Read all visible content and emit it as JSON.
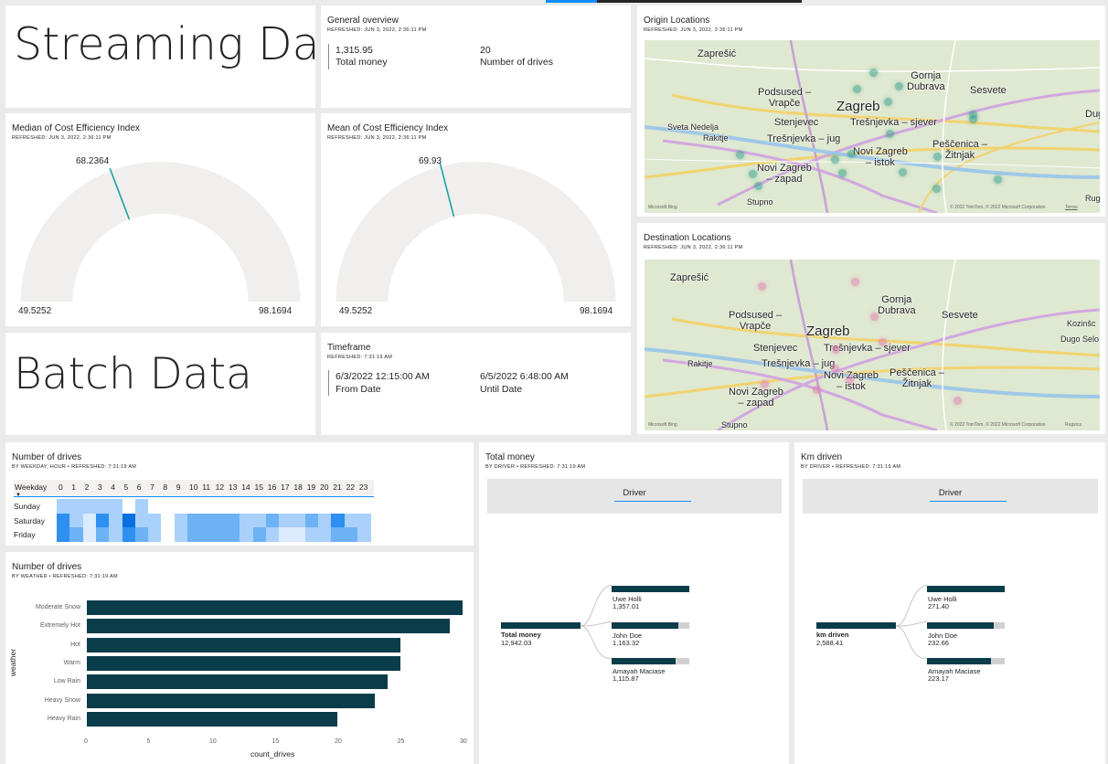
{
  "headers": {
    "streaming": "Streaming Data",
    "batch": "Batch Data"
  },
  "overview": {
    "title": "General overview",
    "refreshed": "REFRESHED: JUN 3, 2022, 2:36:11 PM",
    "total_money_value": "1,315.95",
    "total_money_label": "Total money",
    "drives_value": "20",
    "drives_label": "Number of drives"
  },
  "gauge_median": {
    "title": "Median of Cost Efficiency Index",
    "refreshed": "REFRESHED: JUN 3, 2022, 2:36:11 PM",
    "value": 68.2364,
    "value_label": "68.2364",
    "min": 49.5252,
    "min_label": "49.5252",
    "max": 98.1694,
    "max_label": "98.1694"
  },
  "gauge_mean": {
    "title": "Mean of Cost Efficiency Index",
    "refreshed": "REFRESHED: JUN 3, 2022, 2:36:11 PM",
    "value": 69.93,
    "value_label": "69.93",
    "min": 49.5252,
    "min_label": "49.5252",
    "max": 98.1694,
    "max_label": "98.1694"
  },
  "timeframe": {
    "title": "Timeframe",
    "refreshed": "REFRESHED: 7:31:19 AM",
    "from_value": "6/3/2022 12:15:00 AM",
    "from_label": "From Date",
    "until_value": "6/5/2022 6:48:00 AM",
    "until_label": "Until Date"
  },
  "origin_map": {
    "title": "Origin Locations",
    "refreshed": "REFRESHED: JUN 3, 2022, 2:36:11 PM",
    "dot_color": "#2e9a8c",
    "credit": "Microsoft Bing",
    "copyright": "© 2022 TomTom, © 2022 Microsoft Corporation",
    "terms": "Terms",
    "places": {
      "zapresic": "Zaprešić",
      "podsused": "Podsused –\nVrapče",
      "gornja": "Gornja\nDubrava",
      "sesvete": "Sesvete",
      "dug": "Dug",
      "sveta": "Sveta Nedelja",
      "rakitje": "Rakitje",
      "stenjevec": "Stenjevec",
      "zagreb": "Zagreb",
      "tresnjevka_s": "Trešnjevka – sjever",
      "tresnjevka_j": "Trešnjevka – jug",
      "pescenica": "Peščenica –\nŽitnjak",
      "novi_istok": "Novi Zagreb\n– istok",
      "novi_zapad": "Novi Zagreb\n– zapad",
      "stupno": "Stupno",
      "rugvica": "Rugvi"
    }
  },
  "dest_map": {
    "title": "Destination Locations",
    "refreshed": "REFRESHED: JUN 3, 2022, 2:36:11 PM",
    "dot_color": "#e07ab0",
    "credit": "Microsoft Bing",
    "copyright": "© 2022 TomTom, © 2022 Microsoft Corporation",
    "terms": "Rugvica",
    "places": {
      "zapresic": "Zaprešić",
      "podsused": "Podsused –\nVrapče",
      "gornja": "Gornja\nDubrava",
      "sesvete": "Sesvete",
      "kozinsc": "Kozinšc",
      "dugo": "Dugo Selo",
      "rakitje": "Rakitje",
      "stenjevec": "Stenjevec",
      "zagreb": "Zagreb",
      "tresnjevka_s": "Trešnjevka – sjever",
      "tresnjevka_j": "Trešnjevka – jug",
      "pescenica": "Peščenica –\nŽitnjak",
      "novi_istok": "Novi Zagreb\n– istok",
      "novi_zapad": "Novi Zagreb\n– zapad",
      "stupno": "Stupno"
    }
  },
  "drives_heatmap": {
    "title": "Number of drives",
    "subtitle": "BY WEEKDAY, HOUR  •  REFRESHED: 7:31:19 AM",
    "row_header": "Weekday",
    "sort_icon": "sort-down-icon",
    "hours": [
      "0",
      "1",
      "2",
      "3",
      "4",
      "5",
      "6",
      "7",
      "8",
      "9",
      "10",
      "11",
      "12",
      "13",
      "14",
      "15",
      "16",
      "17",
      "18",
      "19",
      "20",
      "21",
      "22",
      "23"
    ],
    "rows": [
      "Sunday",
      "Saturday",
      "Friday"
    ],
    "levels": [
      [
        2,
        2,
        2,
        2,
        2,
        0,
        2,
        0,
        0,
        0,
        0,
        0,
        0,
        0,
        0,
        0,
        0,
        0,
        0,
        0,
        0,
        0,
        0,
        0
      ],
      [
        4,
        2,
        1,
        4,
        2,
        5,
        2,
        2,
        0,
        2,
        3,
        3,
        3,
        3,
        2,
        2,
        3,
        2,
        2,
        3,
        2,
        4,
        2,
        2
      ],
      [
        4,
        3,
        1,
        3,
        2,
        4,
        3,
        2,
        0,
        2,
        3,
        3,
        3,
        3,
        2,
        3,
        2,
        1,
        1,
        2,
        2,
        3,
        3,
        2
      ]
    ],
    "palette": [
      "#ffffff",
      "#dbeafe",
      "#a9d1fb",
      "#6cb2f5",
      "#2f8ff0",
      "#0a6fe0"
    ]
  },
  "weather_chart": {
    "title": "Number of drives",
    "subtitle": "BY WEATHER  •  REFRESHED: 7:31:19 AM",
    "ylabel": "weather",
    "xlabel": "count_drives",
    "xticks": [
      "0",
      "5",
      "10",
      "15",
      "20",
      "25",
      "30"
    ]
  },
  "chart_data": {
    "type": "bar",
    "orientation": "horizontal",
    "categories": [
      "Moderate Snow",
      "Extremely Hot",
      "Hot",
      "Warm",
      "Low Rain",
      "Heavy Snow",
      "Heavy Rain"
    ],
    "values": [
      30,
      29,
      25,
      25,
      24,
      23,
      20
    ],
    "xlim": [
      0,
      30
    ],
    "xlabel": "count_drives",
    "ylabel": "weather",
    "color": "#0b3c49"
  },
  "money_tree": {
    "title": "Total money",
    "subtitle": "BY DRIVER  •  REFRESHED: 7:31:19 AM",
    "level_header": "Driver",
    "root_label": "Total money",
    "root_value": "12,942.03",
    "children": [
      {
        "name": "Uwe Holli",
        "value": "1,357.01",
        "ratio": 1.0
      },
      {
        "name": "John Doe",
        "value": "1,163.32",
        "ratio": 0.857
      },
      {
        "name": "Amayah Maciase",
        "value": "1,115.87",
        "ratio": 0.822
      }
    ]
  },
  "km_tree": {
    "title": "Km driven",
    "subtitle": "BY DRIVER  •  REFRESHED: 7:31:19 AM",
    "level_header": "Driver",
    "root_label": "km driven",
    "root_value": "2,588.41",
    "children": [
      {
        "name": "Uwe Holli",
        "value": "271.40",
        "ratio": 1.0
      },
      {
        "name": "John Doe",
        "value": "232.66",
        "ratio": 0.857
      },
      {
        "name": "Amayah Maciase",
        "value": "223.17",
        "ratio": 0.822
      }
    ]
  },
  "colors": {
    "accent": "#118dff",
    "dark_bar": "#0b3c49",
    "gauge_track": "#f0efee",
    "gauge_needle": "#1aa3a3"
  }
}
